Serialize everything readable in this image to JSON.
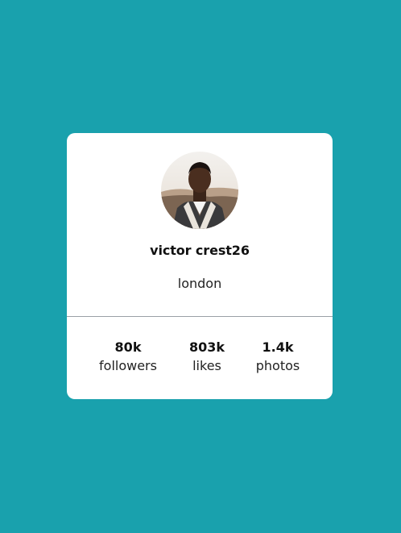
{
  "profile": {
    "name": "victor crest26",
    "location": "london",
    "avatar_icon": "profile-photo"
  },
  "stats": [
    {
      "value": "80k",
      "label": "followers"
    },
    {
      "value": "803k",
      "label": "likes"
    },
    {
      "value": "1.4k",
      "label": "photos"
    }
  ],
  "colors": {
    "background": "#19a1ad",
    "card": "#ffffff",
    "divider": "#9aa0a6"
  }
}
